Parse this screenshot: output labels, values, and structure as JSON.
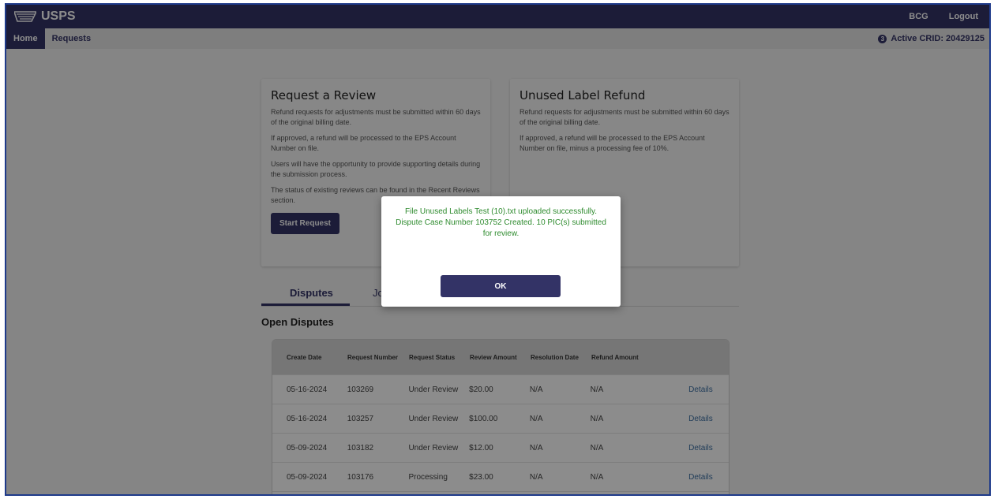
{
  "header": {
    "brand": "USPS",
    "user_button": "BCG",
    "logout_button": "Logout"
  },
  "nav": {
    "items": [
      {
        "label": "Home",
        "active": true
      },
      {
        "label": "Requests",
        "active": false
      }
    ],
    "crid_count": "3",
    "crid_label": "Active CRID: 20429125"
  },
  "review_card": {
    "title": "Request a Review",
    "paragraphs": [
      "Refund requests for adjustments must be submitted within 60 days of the original billing date.",
      "If approved, a refund will be processed to the EPS Account Number on file.",
      "Users will have the opportunity to provide supporting details during the submission process.",
      "The status of existing reviews can be found in the Recent Reviews section."
    ],
    "button": "Start Request"
  },
  "refund_card": {
    "title": "Unused Label Refund",
    "paragraphs": [
      "Refund requests for adjustments must be submitted within 60 days of the original billing date.",
      "If approved, a refund will be processed to the EPS Account Number on file, minus a processing fee of 10%."
    ]
  },
  "tabs": [
    "Disputes",
    "Jo"
  ],
  "open_disputes": {
    "title": "Open Disputes",
    "columns": [
      "Create Date",
      "Request Number",
      "Request Status",
      "Review Amount",
      "Resolution Date",
      "Refund Amount"
    ],
    "rows": [
      {
        "date": "05-16-2024",
        "number": "103269",
        "status": "Under Review",
        "amount": "$20.00",
        "resolution": "N/A",
        "refund": "N/A",
        "link": "Details"
      },
      {
        "date": "05-16-2024",
        "number": "103257",
        "status": "Under Review",
        "amount": "$100.00",
        "resolution": "N/A",
        "refund": "N/A",
        "link": "Details"
      },
      {
        "date": "05-09-2024",
        "number": "103182",
        "status": "Under Review",
        "amount": "$12.00",
        "resolution": "N/A",
        "refund": "N/A",
        "link": "Details"
      },
      {
        "date": "05-09-2024",
        "number": "103176",
        "status": "Processing",
        "amount": "$23.00",
        "resolution": "N/A",
        "refund": "N/A",
        "link": "Details"
      }
    ]
  },
  "modal": {
    "message": "File Unused Labels Test (10).txt uploaded successfully. Dispute Case Number 103752 Created. 10 PIC(s) submitted for review.",
    "ok_button": "OK"
  },
  "colors": {
    "brand_navy": "#333366",
    "success_green": "#2e8b2e",
    "link_blue": "#3d6fa3"
  }
}
